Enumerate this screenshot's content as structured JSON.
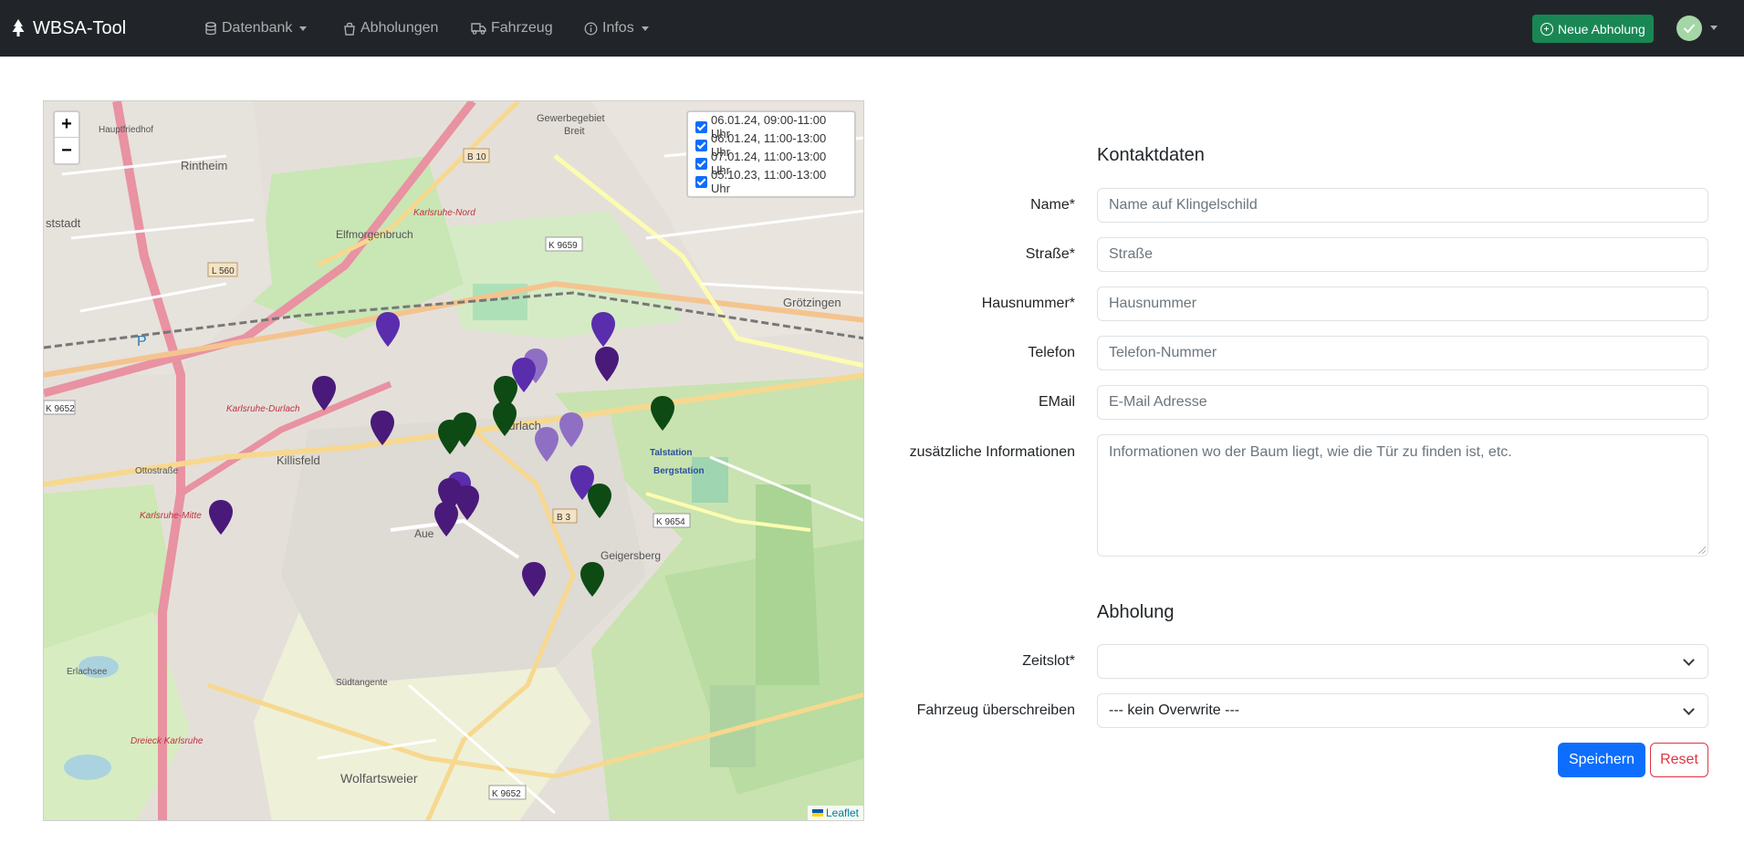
{
  "navbar": {
    "brand": "WBSA-Tool",
    "items": [
      {
        "label": "Datenbank",
        "icon": "database-icon",
        "dropdown": true
      },
      {
        "label": "Abholungen",
        "icon": "bag-icon",
        "dropdown": false
      },
      {
        "label": "Fahrzeug",
        "icon": "truck-icon",
        "dropdown": false
      },
      {
        "label": "Infos",
        "icon": "info-circle-icon",
        "dropdown": true
      }
    ],
    "new_button": "Neue Abholung",
    "user_icon": "check-icon"
  },
  "map": {
    "zoom_in": "+",
    "zoom_out": "−",
    "layers": [
      {
        "label": "06.01.24, 09:00-11:00 Uhr",
        "checked": true
      },
      {
        "label": "06.01.24, 11:00-13:00 Uhr",
        "checked": true
      },
      {
        "label": "07.01.24, 11:00-13:00 Uhr",
        "checked": true
      },
      {
        "label": "05.10.23, 11:00-13:00 Uhr",
        "checked": true
      }
    ],
    "attribution": "Leaflet",
    "place_labels": {
      "rintheim": "Rintheim",
      "elfmorgenbruch": "Elfmorgenbruch",
      "grotzingen": "Grötzingen",
      "killisfeld": "Killisfeld",
      "aue": "Aue",
      "geigersberg": "Geigersberg",
      "wolfartsweier": "Wolfartsweier",
      "durlach": "Durlach",
      "erlachsee": "Erlachsee",
      "gewerbegebiet": "Gewerbegebiet",
      "breit": "Breit",
      "hauptfriedhof": "Hauptfriedhof",
      "ststadt": "ststadt",
      "talstation": "Talstation",
      "bergstation": "Bergstation",
      "kr_nord": "Karlsruhe-Nord",
      "kr_durlach": "Karlsruhe-Durlach",
      "kr_mitte": "Karlsruhe-Mitte",
      "dreieck": "Dreieck Karlsruhe",
      "ottostrasse": "Ottostraße",
      "suedtangente": "Südtangente",
      "l560": "L 560",
      "b10": "B 10",
      "b3": "B 3",
      "k9659": "K 9659",
      "k9654": "K 9654",
      "k9652": "K 9652",
      "k9652b": "K 9652",
      "p": "P"
    },
    "marker_colors": {
      "dark_purple": "#4a1a7a",
      "purple": "#5a2dac",
      "light_purple": "#8f6fc4",
      "green": "#0d4a14"
    }
  },
  "form": {
    "contact_title": "Kontaktdaten",
    "fields": {
      "name": {
        "label": "Name*",
        "placeholder": "Name auf Klingelschild"
      },
      "street": {
        "label": "Straße*",
        "placeholder": "Straße"
      },
      "number": {
        "label": "Hausnummer*",
        "placeholder": "Hausnummer"
      },
      "phone": {
        "label": "Telefon",
        "placeholder": "Telefon-Nummer"
      },
      "email": {
        "label": "EMail",
        "placeholder": "E-Mail Adresse"
      },
      "info": {
        "label": "zusätzliche Informationen",
        "placeholder": "Informationen wo der Baum liegt, wie die Tür zu finden ist, etc."
      }
    },
    "pickup_title": "Abholung",
    "timeslot": {
      "label": "Zeitslot*",
      "value": ""
    },
    "vehicle": {
      "label": "Fahrzeug überschreiben",
      "value": "--- kein Overwrite ---"
    },
    "save": "Speichern",
    "reset": "Reset"
  }
}
